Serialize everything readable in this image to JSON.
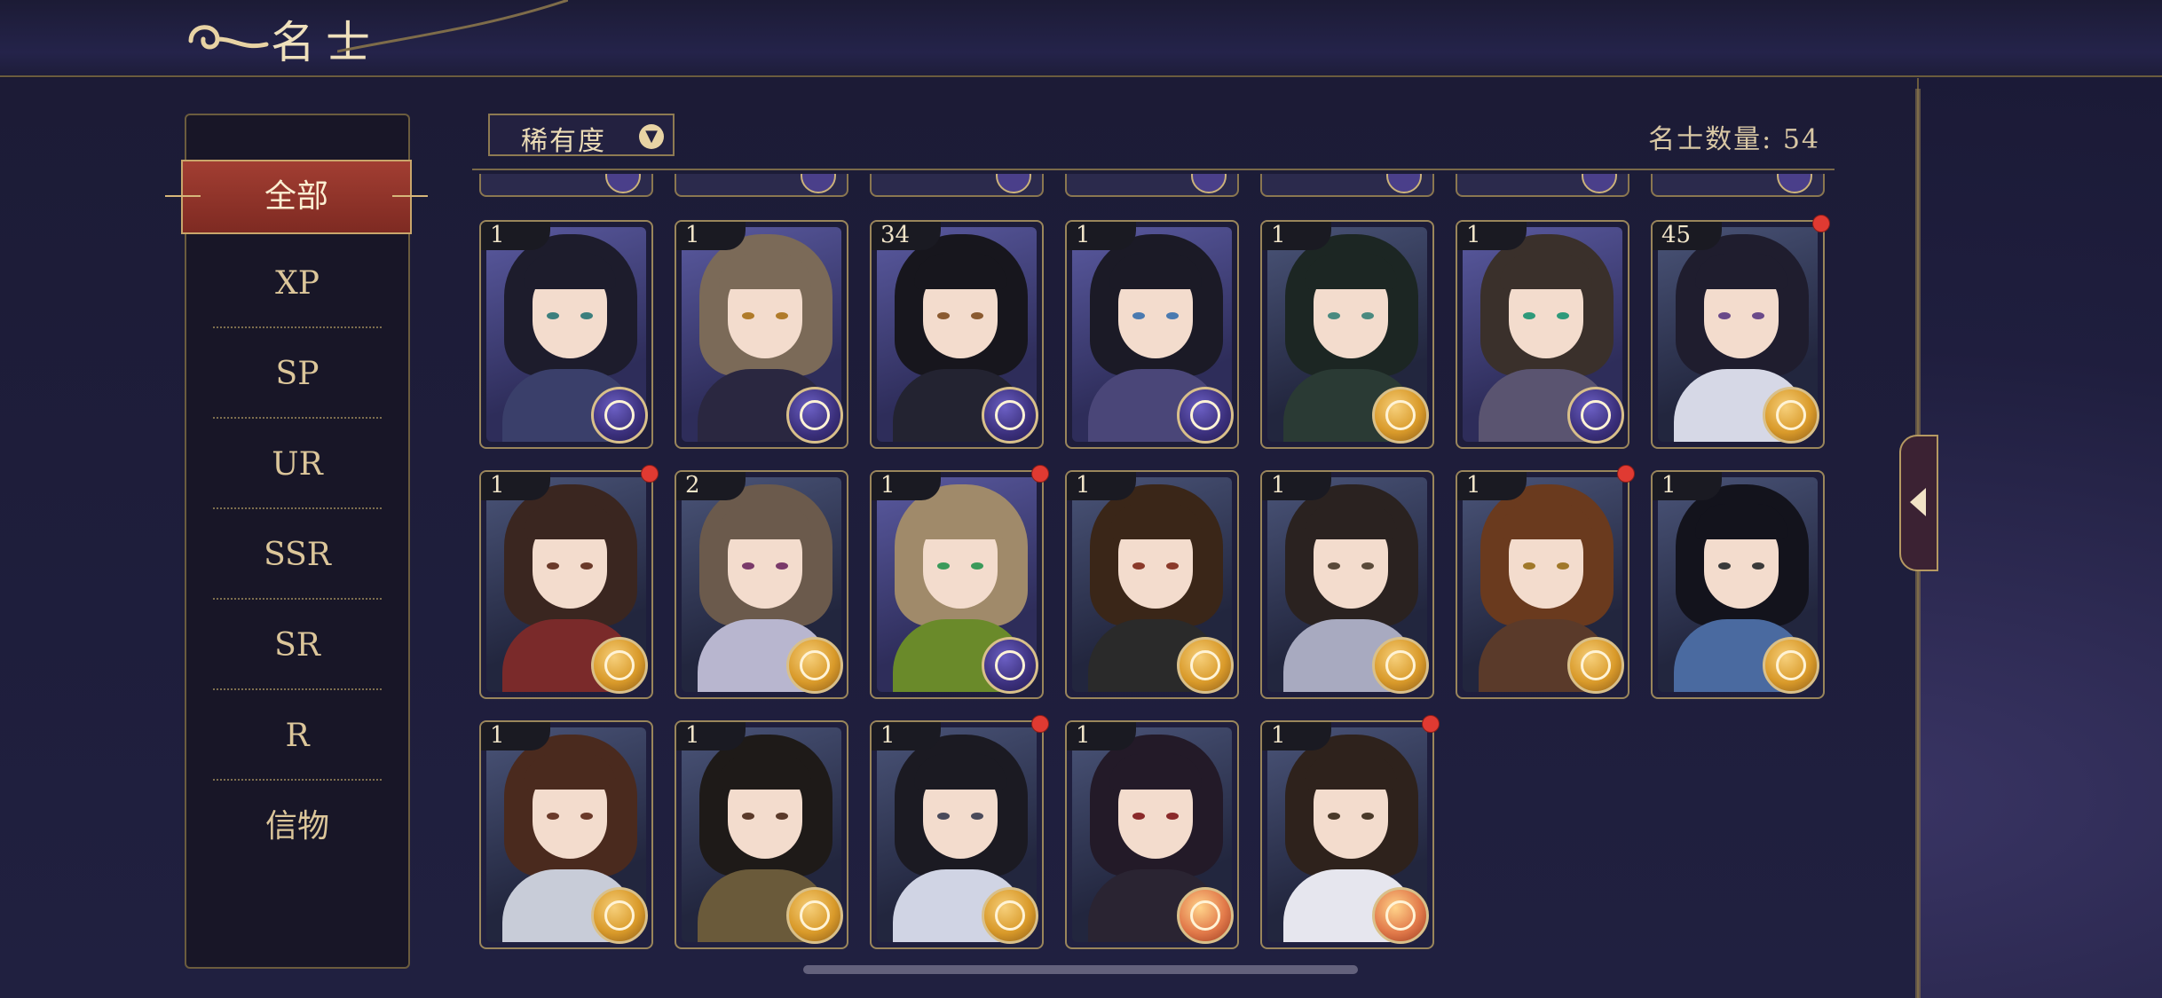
{
  "header": {
    "title": "名士"
  },
  "sidebar": {
    "active": "全部",
    "items": [
      {
        "label": "XP"
      },
      {
        "label": "SP"
      },
      {
        "label": "UR"
      },
      {
        "label": "SSR"
      },
      {
        "label": "SR"
      },
      {
        "label": "R"
      },
      {
        "label": "信物"
      }
    ]
  },
  "toolbar": {
    "filter_label": "稀有度",
    "count_label": "名士数量: 54"
  },
  "cards": [
    {
      "level": "1",
      "emblem": "purple",
      "new": false,
      "hair": "#1d1c2c",
      "robe": "#3a3f6a",
      "eye": "#3c7f7d"
    },
    {
      "level": "1",
      "emblem": "purple",
      "new": false,
      "hair": "#7b6a58",
      "robe": "#2a2740",
      "eye": "#b07b2a"
    },
    {
      "level": "34",
      "emblem": "purple",
      "new": false,
      "hair": "#17161d",
      "robe": "#232331",
      "eye": "#8a5a30"
    },
    {
      "level": "1",
      "emblem": "purple",
      "new": false,
      "hair": "#1b1a26",
      "robe": "#4a4678",
      "eye": "#4a7ab0"
    },
    {
      "level": "1",
      "emblem": "gold",
      "new": false,
      "hair": "#1c2623",
      "robe": "#2a3a34",
      "eye": "#4a8a80"
    },
    {
      "level": "1",
      "emblem": "purple",
      "new": false,
      "hair": "#3a302b",
      "robe": "#5a5470",
      "eye": "#2e9a7a"
    },
    {
      "level": "45",
      "emblem": "gold",
      "new": true,
      "hair": "#1f1d2e",
      "robe": "#d6d8e6",
      "eye": "#6a4a8a"
    },
    {
      "level": "1",
      "emblem": "gold",
      "new": true,
      "hair": "#3a2620",
      "robe": "#7a2a2a",
      "eye": "#6a3a2a"
    },
    {
      "level": "2",
      "emblem": "gold",
      "new": false,
      "hair": "#6b5a4c",
      "robe": "#b8b6cf",
      "eye": "#7a3a6a"
    },
    {
      "level": "1",
      "emblem": "purple",
      "new": true,
      "hair": "#a08a6a",
      "robe": "#6a8a2a",
      "eye": "#3a9a5a"
    },
    {
      "level": "1",
      "emblem": "gold",
      "new": false,
      "hair": "#3a2618",
      "robe": "#2a2a2a",
      "eye": "#8a3a2a"
    },
    {
      "level": "1",
      "emblem": "gold",
      "new": false,
      "hair": "#2a2220",
      "robe": "#a8aac0",
      "eye": "#5a4a3a"
    },
    {
      "level": "1",
      "emblem": "gold",
      "new": true,
      "hair": "#6a3a1e",
      "robe": "#5a3a2a",
      "eye": "#a0782a"
    },
    {
      "level": "1",
      "emblem": "gold",
      "new": false,
      "hair": "#13131c",
      "robe": "#4a6aa0",
      "eye": "#3a3a3a"
    },
    {
      "level": "1",
      "emblem": "gold",
      "new": false,
      "hair": "#4a2a1e",
      "robe": "#c8ccd8",
      "eye": "#6a3a2a"
    },
    {
      "level": "1",
      "emblem": "gold",
      "new": false,
      "hair": "#1e1a18",
      "robe": "#6a5a3a",
      "eye": "#5a3a2a"
    },
    {
      "level": "1",
      "emblem": "gold",
      "new": true,
      "hair": "#1b1a22",
      "robe": "#d0d4e4",
      "eye": "#4a4a5a"
    },
    {
      "level": "1",
      "emblem": "red-gold",
      "new": false,
      "hair": "#231a28",
      "robe": "#2a2432",
      "eye": "#8a2a2a"
    },
    {
      "level": "1",
      "emblem": "red-gold",
      "new": true,
      "hair": "#2e221c",
      "robe": "#e6e6ee",
      "eye": "#4a3a2a"
    }
  ],
  "colors": {
    "emblem_purple": "#3a2f7a",
    "emblem_gold": "#d99a2a",
    "emblem_red_gold": "#e27a4a",
    "accent_red": "#8e3129",
    "gold_trim": "#c9a66b"
  }
}
